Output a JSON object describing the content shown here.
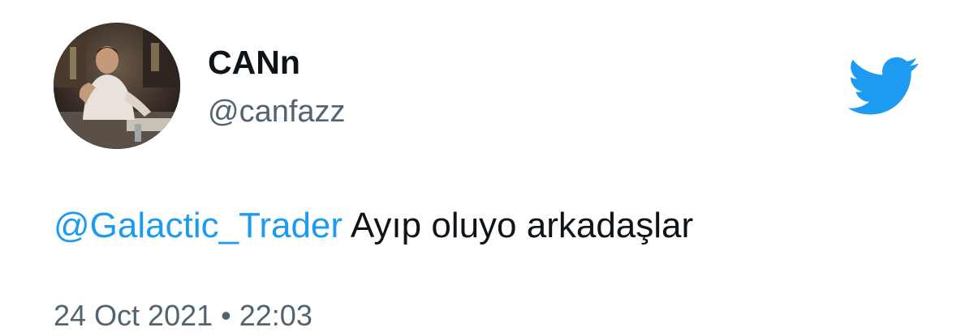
{
  "tweet": {
    "author": {
      "display_name": "CANn",
      "handle": "@canfazz"
    },
    "logo_icon": "twitter-bird-icon",
    "text": {
      "mention": "@Galactic_Trader",
      "message": " Ayıp oluyo arkadaşlar"
    },
    "meta": {
      "date": "24 Oct 2021",
      "separator": " • ",
      "time": "22:03"
    },
    "colors": {
      "accent": "#1d9bf0",
      "text": "#0f1419",
      "secondary": "#536471"
    }
  }
}
